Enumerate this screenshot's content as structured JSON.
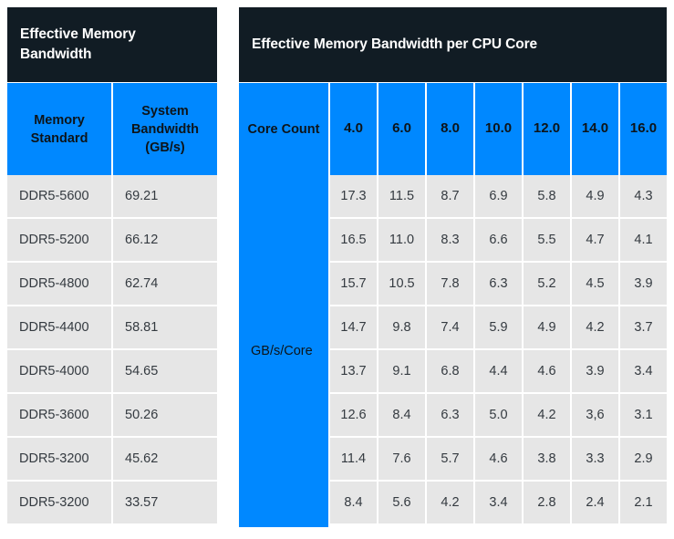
{
  "left_table": {
    "title": "Effective Memory Bandwidth",
    "headers": {
      "memory_standard": "Memory Standard",
      "system_bandwidth": "System Bandwidth (GB/s)"
    },
    "rows": [
      {
        "standard": "DDR5-5600",
        "bandwidth": "69.21"
      },
      {
        "standard": "DDR5-5200",
        "bandwidth": "66.12"
      },
      {
        "standard": "DDR5-4800",
        "bandwidth": "62.74"
      },
      {
        "standard": "DDR5-4400",
        "bandwidth": "58.81"
      },
      {
        "standard": "DDR5-4000",
        "bandwidth": "54.65"
      },
      {
        "standard": "DDR5-3600",
        "bandwidth": "50.26"
      },
      {
        "standard": "DDR5-3200",
        "bandwidth": "45.62"
      },
      {
        "standard": "DDR5-3200",
        "bandwidth": "33.57"
      }
    ]
  },
  "right_table": {
    "title": "Effective Memory Bandwidth per CPU Core",
    "headers": {
      "core_count": "Core Count",
      "core_values": [
        "4.0",
        "6.0",
        "8.0",
        "10.0",
        "12.0",
        "14.0",
        "16.0"
      ]
    },
    "unit_label": "GB/s/Core",
    "rows": [
      [
        "17.3",
        "11.5",
        "8.7",
        "6.9",
        "5.8",
        "4.9",
        "4.3"
      ],
      [
        "16.5",
        "11.0",
        "8.3",
        "6.6",
        "5.5",
        "4.7",
        "4.1"
      ],
      [
        "15.7",
        "10.5",
        "7.8",
        "6.3",
        "5.2",
        "4.5",
        "3.9"
      ],
      [
        "14.7",
        "9.8",
        "7.4",
        "5.9",
        "4.9",
        "4.2",
        "3.7"
      ],
      [
        "13.7",
        "9.1",
        "6.8",
        "4.4",
        "4.6",
        "3.9",
        "3.4"
      ],
      [
        "12.6",
        "8.4",
        "6.3",
        "5.0",
        "4.2",
        "3,6",
        "3.1"
      ],
      [
        "11.4",
        "7.6",
        "5.7",
        "4.6",
        "3.8",
        "3.3",
        "2.9"
      ],
      [
        "8.4",
        "5.6",
        "4.2",
        "3.4",
        "2.8",
        "2.4",
        "2.1"
      ]
    ]
  },
  "chart_data": {
    "type": "table",
    "title": "Effective Memory Bandwidth and Effective Memory Bandwidth per CPU Core",
    "categories": [
      "DDR5-5600",
      "DDR5-5200",
      "DDR5-4800",
      "DDR5-4400",
      "DDR5-4000",
      "DDR5-3600",
      "DDR5-3200",
      "DDR5-3200"
    ],
    "xlabel": "Core Count",
    "ylabel": "Memory Standard",
    "system_bandwidth_gbps": [
      69.21,
      66.12,
      62.74,
      58.81,
      54.65,
      50.26,
      45.62,
      33.57
    ],
    "core_counts": [
      4.0,
      6.0,
      8.0,
      10.0,
      12.0,
      14.0,
      16.0
    ],
    "unit": "GB/s/Core",
    "series": [
      {
        "name": "DDR5-5600",
        "values": [
          17.3,
          11.5,
          8.7,
          6.9,
          5.8,
          4.9,
          4.3
        ]
      },
      {
        "name": "DDR5-5200",
        "values": [
          16.5,
          11.0,
          8.3,
          6.6,
          5.5,
          4.7,
          4.1
        ]
      },
      {
        "name": "DDR5-4800",
        "values": [
          15.7,
          10.5,
          7.8,
          6.3,
          5.2,
          4.5,
          3.9
        ]
      },
      {
        "name": "DDR5-4400",
        "values": [
          14.7,
          9.8,
          7.4,
          5.9,
          4.9,
          4.2,
          3.7
        ]
      },
      {
        "name": "DDR5-4000",
        "values": [
          13.7,
          9.1,
          6.8,
          4.4,
          4.6,
          3.9,
          3.4
        ]
      },
      {
        "name": "DDR5-3600",
        "values": [
          12.6,
          8.4,
          6.3,
          5.0,
          4.2,
          3.6,
          3.1
        ]
      },
      {
        "name": "DDR5-3200",
        "values": [
          11.4,
          7.6,
          5.7,
          4.6,
          3.8,
          3.3,
          2.9
        ]
      },
      {
        "name": "DDR5-3200",
        "values": [
          8.4,
          5.6,
          4.2,
          3.4,
          2.8,
          2.4,
          2.1
        ]
      }
    ],
    "grid": true,
    "legend": "none"
  },
  "colors": {
    "header_dark": "#111c24",
    "accent_blue": "#0088ff",
    "row_gray": "#e6e6e6",
    "text_dark": "#343a40",
    "text_light": "#ffffff"
  }
}
